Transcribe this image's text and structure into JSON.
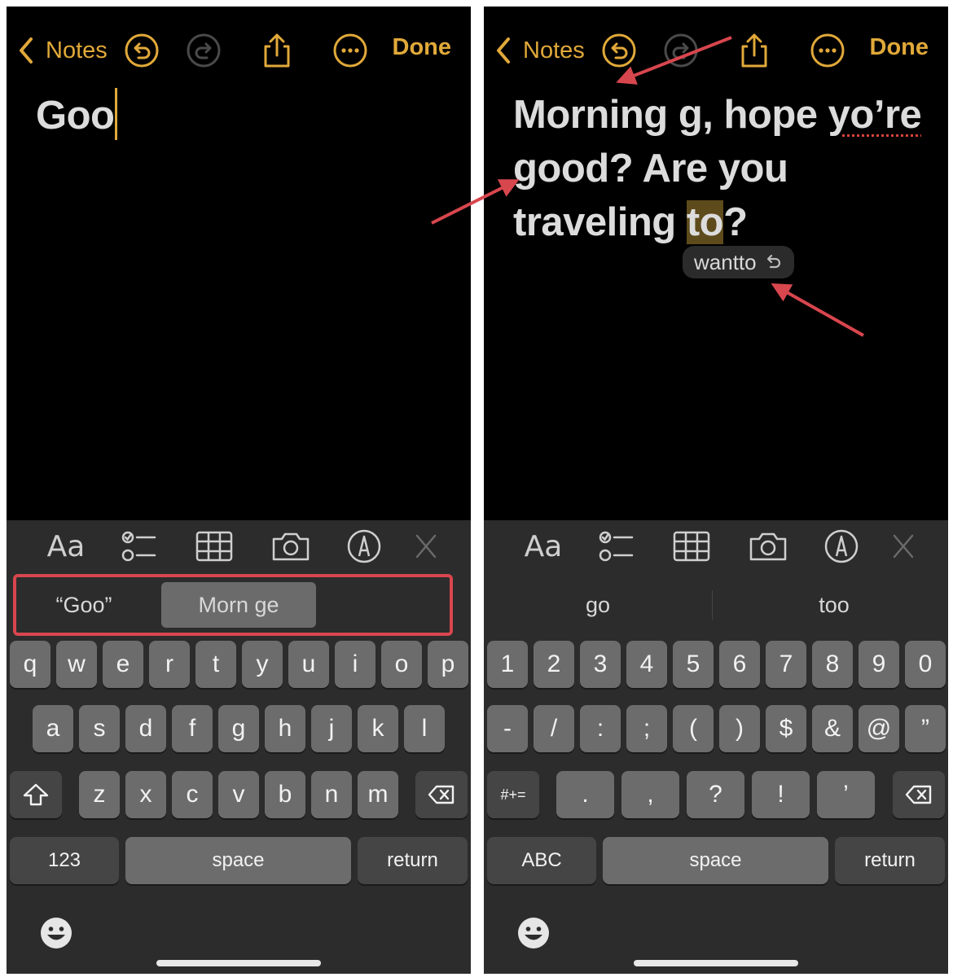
{
  "colors": {
    "accent": "#e1a93a",
    "annotation": "#d8464e",
    "keyboard_bg": "#2c2c2c",
    "key_bg": "#6c6c6c",
    "key_dark_bg": "#454545"
  },
  "left": {
    "nav": {
      "back_label": "Notes",
      "done_label": "Done",
      "icons": [
        "chevron-left-icon",
        "undo-icon",
        "redo-icon",
        "share-icon",
        "more-icon"
      ]
    },
    "note": {
      "text": "Goo"
    },
    "toolbar": {
      "format_label": "Aa",
      "icons": [
        "checklist-icon",
        "table-icon",
        "camera-icon",
        "markup-icon",
        "close-icon"
      ]
    },
    "suggestions": [
      {
        "label": "“Goo”",
        "selected": false
      },
      {
        "label": "Morn ge",
        "selected": true
      }
    ],
    "keyboard": {
      "row1": [
        "q",
        "w",
        "e",
        "r",
        "t",
        "y",
        "u",
        "i",
        "o",
        "p"
      ],
      "row2": [
        "a",
        "s",
        "d",
        "f",
        "g",
        "h",
        "j",
        "k",
        "l"
      ],
      "row3": [
        "z",
        "x",
        "c",
        "v",
        "b",
        "n",
        "m"
      ],
      "mode_key": "123",
      "space": "space",
      "return": "return"
    }
  },
  "right": {
    "nav": {
      "back_label": "Notes",
      "done_label": "Done",
      "icons": [
        "chevron-left-icon",
        "undo-icon",
        "redo-icon",
        "share-icon",
        "more-icon"
      ]
    },
    "note": {
      "part1": "Morning g, hope ",
      "misspelled": "yo’re",
      "part2": " good? Are you traveling ",
      "highlighted": "to",
      "part3": "?"
    },
    "autocorrect": {
      "label": "wantto",
      "icon": "revert-icon"
    },
    "toolbar": {
      "format_label": "Aa",
      "icons": [
        "checklist-icon",
        "table-icon",
        "camera-icon",
        "markup-icon",
        "close-icon"
      ]
    },
    "suggestions": [
      {
        "label": "go",
        "selected": false
      },
      {
        "label": "too",
        "selected": false
      }
    ],
    "keyboard": {
      "row1": [
        "1",
        "2",
        "3",
        "4",
        "5",
        "6",
        "7",
        "8",
        "9",
        "0"
      ],
      "row2": [
        "-",
        "/",
        ":",
        ";",
        "(",
        ")",
        "$",
        "&",
        "@",
        "”"
      ],
      "row3": [
        ".",
        ",",
        "?",
        "!",
        "’"
      ],
      "symbols_key": "#+=",
      "mode_key": "ABC",
      "space": "space",
      "return": "return"
    }
  }
}
